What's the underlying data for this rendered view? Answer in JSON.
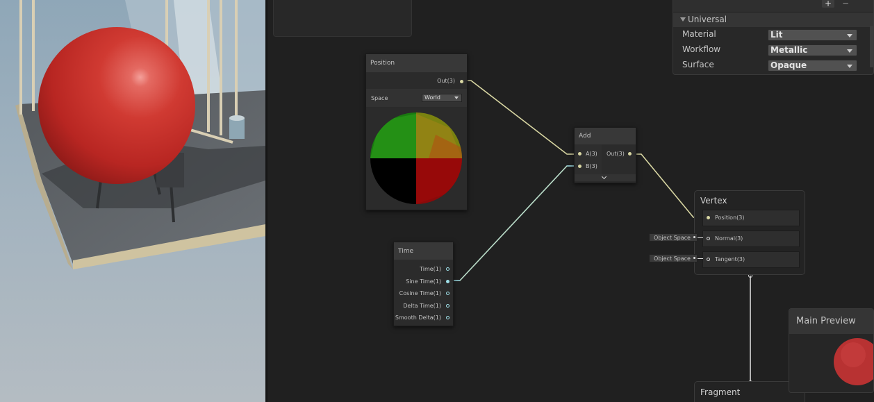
{
  "colors": {
    "background": "#202020",
    "node_body": "#2b2b2b",
    "node_header": "#383838",
    "vector3_wire": "#d8d6a2",
    "float_wire": "#9fe0e8",
    "sphere": "#c42a24"
  },
  "position_node": {
    "title": "Position",
    "output": "Out(3)",
    "space_label": "Space",
    "space_value": "World"
  },
  "add_node": {
    "title": "Add",
    "inputs": [
      "A(3)",
      "B(3)"
    ],
    "output": "Out(3)",
    "expand_icon": "chevron-down-icon"
  },
  "time_node": {
    "title": "Time",
    "outputs": [
      "Time(1)",
      "Sine Time(1)",
      "Cosine Time(1)",
      "Delta Time(1)",
      "Smooth Delta(1)"
    ]
  },
  "vertex_block": {
    "title": "Vertex",
    "slots": [
      "Position(3)",
      "Normal(3)",
      "Tangent(3)"
    ],
    "normal_space": "Object Space",
    "tangent_space": "Object Space"
  },
  "fragment_block": {
    "title": "Fragment"
  },
  "main_preview": {
    "title": "Main Preview"
  },
  "graph_inspector": {
    "section": "Universal",
    "add_icon": "plus-icon",
    "remove_icon": "minus-icon",
    "fields": [
      {
        "label": "Material",
        "value": "Lit"
      },
      {
        "label": "Workflow",
        "value": "Metallic"
      },
      {
        "label": "Surface",
        "value": "Opaque"
      }
    ]
  }
}
